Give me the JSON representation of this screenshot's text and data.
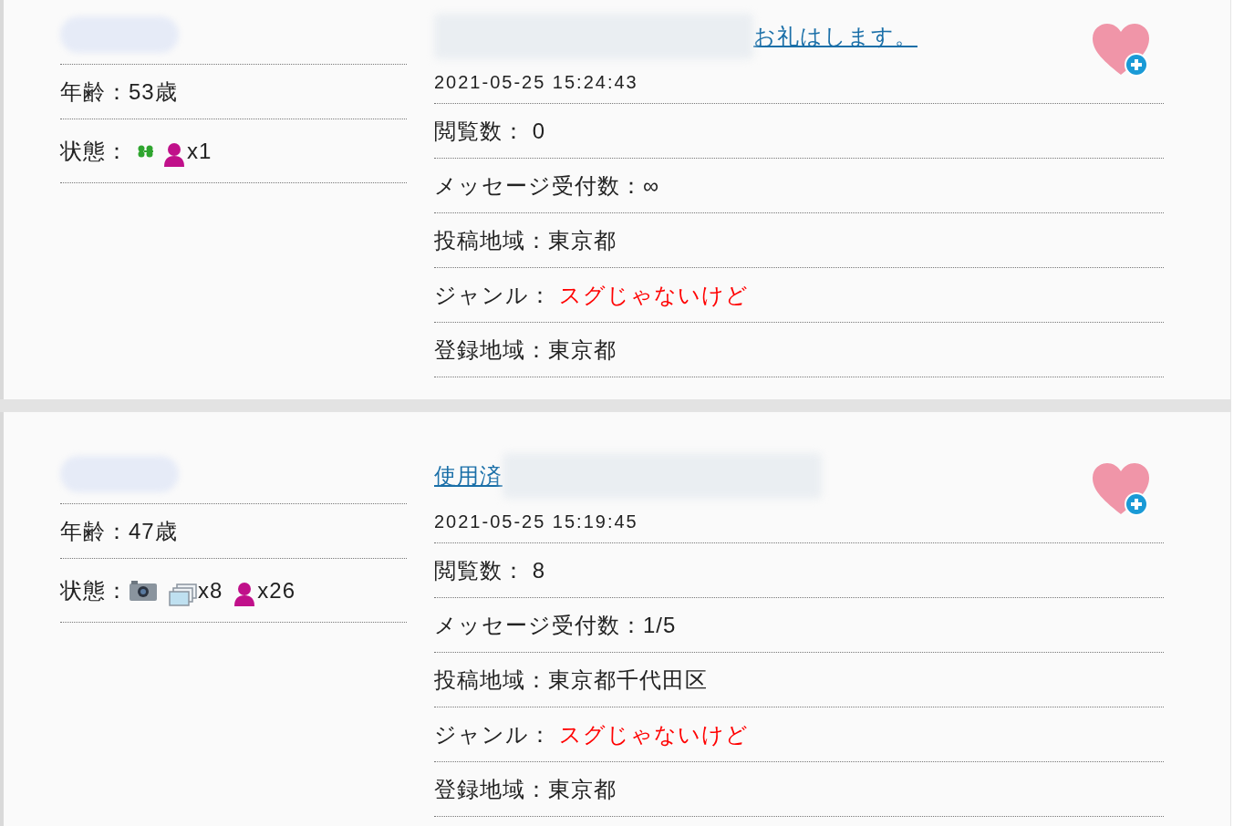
{
  "posts": [
    {
      "title_parts": [
        {
          "kind": "blur"
        },
        {
          "kind": "link",
          "text": "お礼はします。"
        }
      ],
      "date": "2021-05-25 15:24:43",
      "age": "年齢：53歳",
      "status_label": "状態：",
      "status": [
        {
          "kind": "clover"
        },
        {
          "kind": "person",
          "count": "x1"
        }
      ],
      "fields": [
        {
          "label": "閲覧数：",
          "value": " 0",
          "highlight": false
        },
        {
          "label": "メッセージ受付数：",
          "value": "∞",
          "highlight": false
        },
        {
          "label": "投稿地域：",
          "value": "東京都",
          "highlight": false
        },
        {
          "label": "ジャンル：",
          "value": " スグじゃないけど",
          "highlight": true
        },
        {
          "label": "登録地域：",
          "value": "東京都",
          "highlight": false
        }
      ]
    },
    {
      "title_parts": [
        {
          "kind": "link",
          "text": "使用済"
        },
        {
          "kind": "blur"
        }
      ],
      "date": "2021-05-25 15:19:45",
      "age": "年齢：47歳",
      "status_label": "状態：",
      "status": [
        {
          "kind": "camera"
        },
        {
          "kind": "photos",
          "count": "x8"
        },
        {
          "kind": "person",
          "count": "x26"
        }
      ],
      "fields": [
        {
          "label": "閲覧数：",
          "value": " 8",
          "highlight": false
        },
        {
          "label": "メッセージ受付数：",
          "value": "1/5",
          "highlight": false
        },
        {
          "label": "投稿地域：",
          "value": "東京都千代田区",
          "highlight": false
        },
        {
          "label": "ジャンル：",
          "value": " スグじゃないけど",
          "highlight": true
        },
        {
          "label": "登録地域：",
          "value": "東京都",
          "highlight": false
        }
      ]
    }
  ]
}
